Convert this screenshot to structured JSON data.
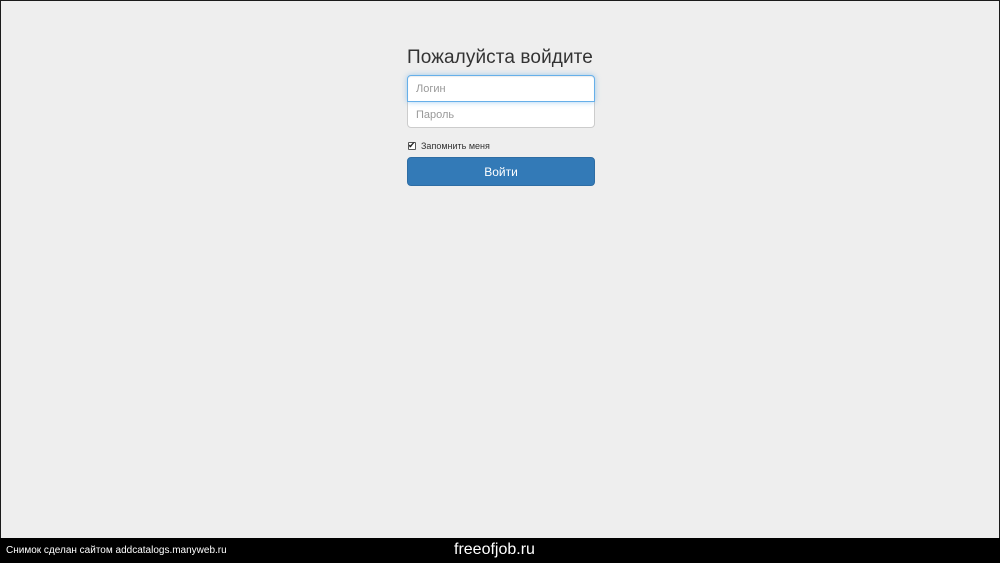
{
  "login_form": {
    "heading": "Пожалуйста войдите",
    "login_placeholder": "Логин",
    "login_value": "",
    "password_placeholder": "Пароль",
    "password_value": "",
    "remember_label": "Запомнить меня",
    "remember_checked": true,
    "submit_label": "Войти"
  },
  "colors": {
    "page_background": "#eeeeee",
    "button_primary": "#337ab7",
    "focus_ring": "#66afe9",
    "footer_background": "#000000"
  },
  "footer": {
    "credit_text": "Снимок сделан сайтом addcatalogs.manyweb.ru",
    "site_name": "freeofjob.ru"
  }
}
